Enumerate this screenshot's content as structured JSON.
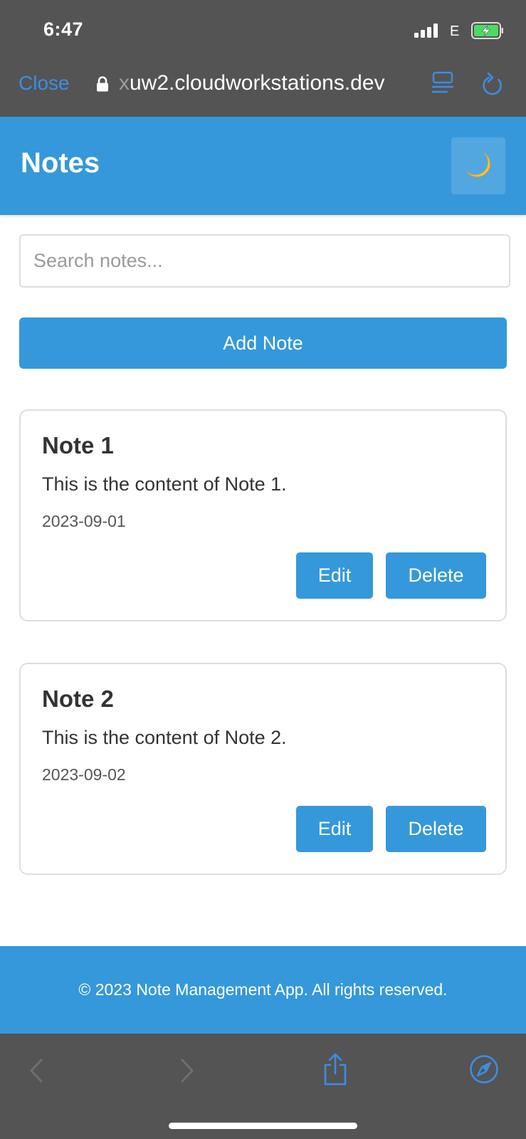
{
  "status_bar": {
    "time": "6:47",
    "network": "E",
    "signal_bars": 4,
    "battery_charging": true
  },
  "browser": {
    "close_label": "Close",
    "url_fade_prefix": "x",
    "url_rest": "uw2.cloudworkstations.dev",
    "icons": [
      "lock-icon",
      "reader-icon",
      "reload-icon",
      "back-icon",
      "forward-icon",
      "share-icon",
      "compass-icon"
    ]
  },
  "header": {
    "title": "Notes",
    "theme_icon": "🌙"
  },
  "search": {
    "placeholder": "Search notes..."
  },
  "add_note": {
    "label": "Add Note"
  },
  "notes": [
    {
      "title": "Note 1",
      "content": "This is the content of Note 1.",
      "date": "2023-09-01",
      "edit_label": "Edit",
      "delete_label": "Delete"
    },
    {
      "title": "Note 2",
      "content": "This is the content of Note 2.",
      "date": "2023-09-02",
      "edit_label": "Edit",
      "delete_label": "Delete"
    }
  ],
  "footer": {
    "text": "© 2023 Note Management App. All rights reserved."
  },
  "colors": {
    "accent": "#3498db",
    "safari_chrome": "#545454",
    "link": "#3a8ee6",
    "battery_fill": "#4cd964"
  }
}
